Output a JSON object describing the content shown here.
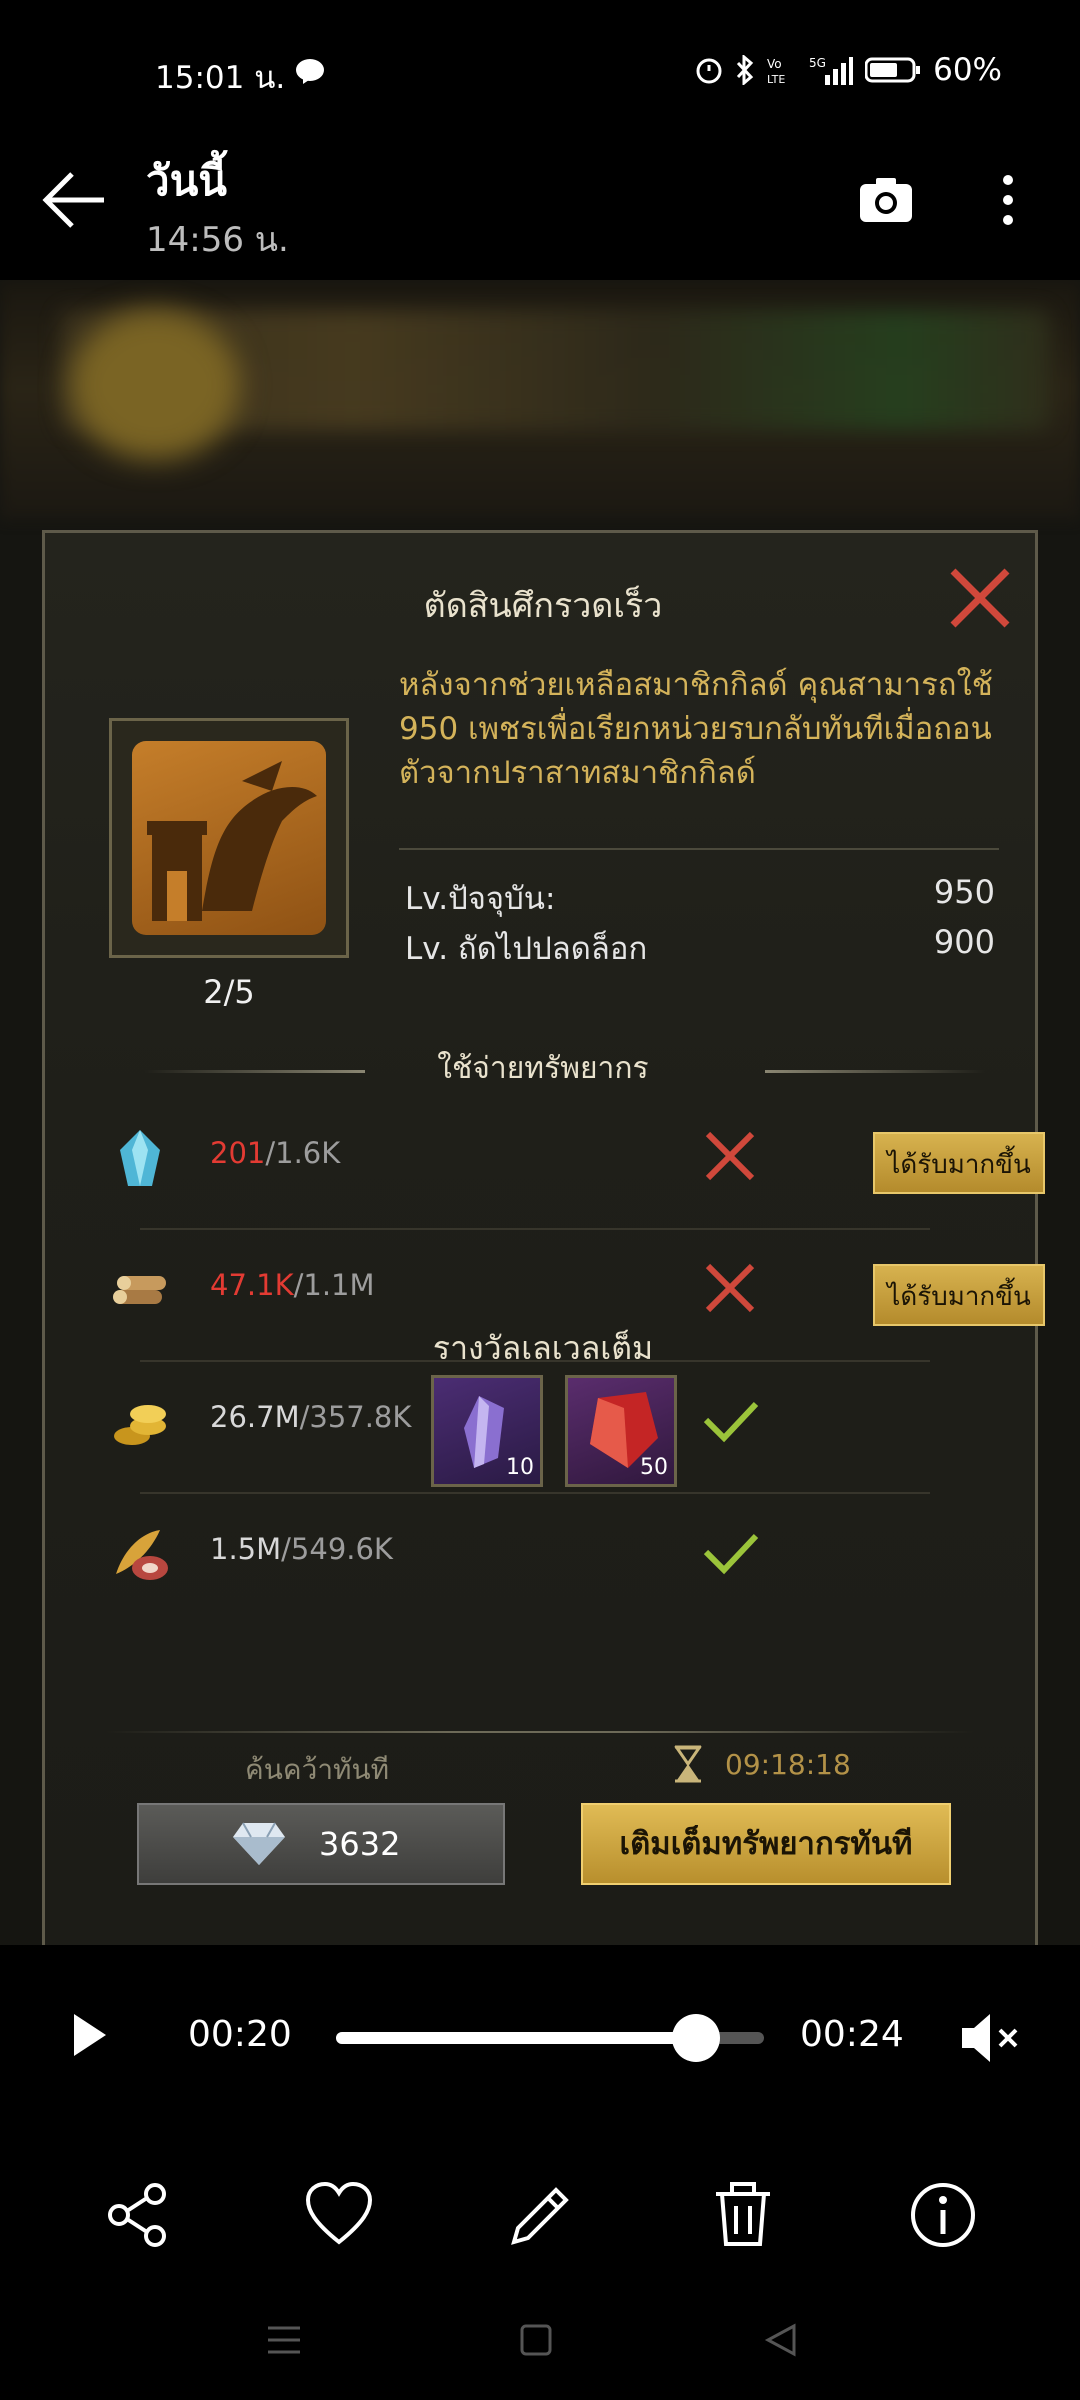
{
  "status_bar": {
    "time": "15:01 น.",
    "battery": "60%"
  },
  "header": {
    "title": "วันนี้",
    "subtitle": "14:56 น."
  },
  "panel": {
    "title": "ตัดสินศึกรวดเร็ว",
    "description": "หลังจากช่วยเหลือสมาชิกกิลด์ คุณสามารถใช้ 950 เพชรเพื่อเรียกหน่วยรบกลับทันทีเมื่อถอนตัวจากปราสาทสมาชิกกิลด์",
    "level": "2/5",
    "current_label": "Lv.ปัจจุบัน:",
    "current_value": "950",
    "next_label": "Lv. ถัดไปปลดล็อก",
    "next_value": "900",
    "resources_title": "ใช้จ่ายทรัพยากร",
    "resources": [
      {
        "icon": "crystal-icon",
        "have": "201",
        "need": "/1.6K",
        "ok": false,
        "button": "ได้รับมากขึ้น"
      },
      {
        "icon": "wood-icon",
        "have": "47.1K",
        "need": "/1.1M",
        "ok": false,
        "button": "ได้รับมากขึ้น"
      },
      {
        "icon": "gold-icon",
        "have": "26.7M",
        "need": "/357.8K",
        "ok": true
      },
      {
        "icon": "food-icon",
        "have": "1.5M",
        "need": "/549.6K",
        "ok": true
      }
    ],
    "reward_title": "รางวัลเลเวลเต็ม",
    "rewards": [
      {
        "icon": "purple-crystal-icon",
        "qty": "10"
      },
      {
        "icon": "red-gem-icon",
        "qty": "50"
      }
    ],
    "research_label": "ค้นคว้าทันที",
    "timer": "09:18:18",
    "gem_cost": "3632",
    "fill_button": "เติมเต็มทรัพยากรทันที"
  },
  "player": {
    "current_time": "00:20",
    "total_time": "00:24",
    "progress": 0.84
  },
  "colors": {
    "accent_gold": "#d4b35a",
    "error_red": "#e33b33",
    "ok_green": "#9bc43a"
  }
}
